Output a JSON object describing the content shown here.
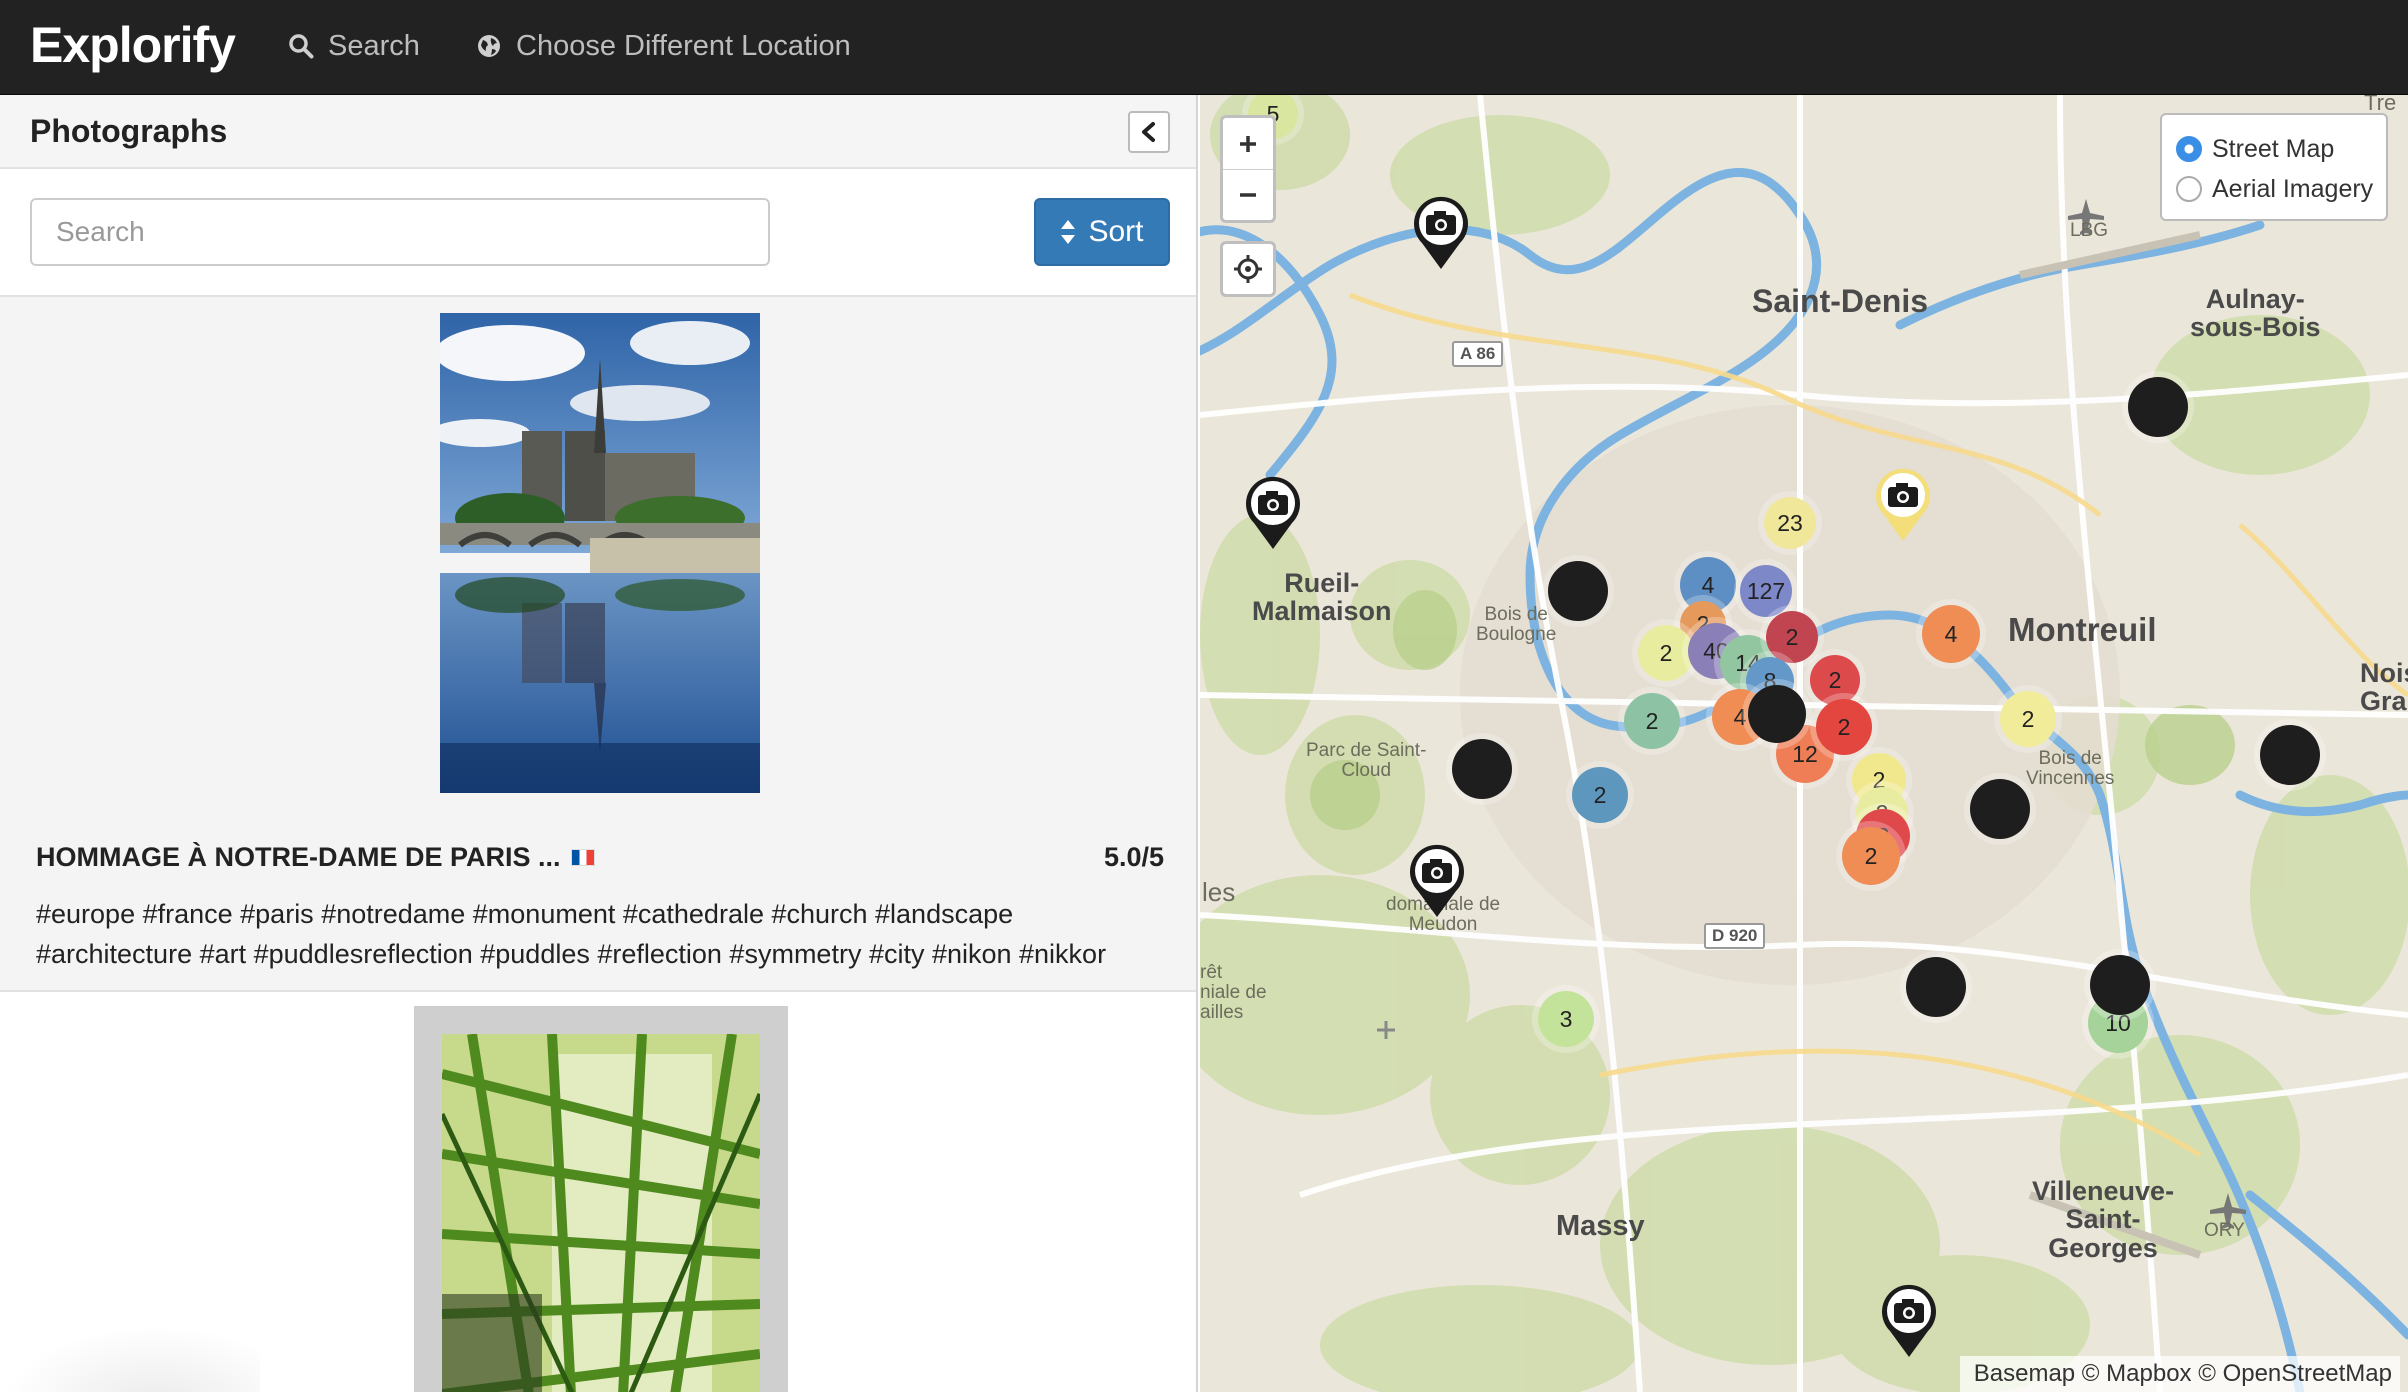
{
  "navbar": {
    "brand": "Explorify",
    "search_label": "Search",
    "location_label": "Choose Different Location"
  },
  "sidebar": {
    "title": "Photographs",
    "search_placeholder": "Search",
    "sort_label": "Sort",
    "photos": [
      {
        "title": "HOMMAGE À NOTRE-DAME DE PARIS ...",
        "rating": "5.0/5",
        "tags": "#europe #france #paris #notredame #monument #cathedrale #church #landscape #architecture #art #puddlesreflection #puddles #reflection #symmetry #city #nikon #nikkor"
      }
    ]
  },
  "map": {
    "layers": [
      "Street Map",
      "Aerial Imagery"
    ],
    "selected_layer": "Street Map",
    "attribution": "Basemap © Mapbox © OpenStreetMap",
    "places": {
      "saint_denis": "Saint-Denis",
      "aulnay": "Aulnay-\nsous-Bois",
      "rueil": "Rueil-\nMalmaison",
      "montreuil": "Montreuil",
      "noisy": "Nois\nGra",
      "massy": "Massy",
      "villeneuve": "Villeneuve-\nSaint-\nGeorges",
      "bois_boulogne": "Bois de\nBoulogne",
      "parc_saint_cloud": "Parc de Saint-\nCloud",
      "bois_vincennes": "Bois de\nVincennes",
      "meudon": "Fo\ndomaniale de\nMeudon",
      "les": "les",
      "foret": "rêt\nniale de\nailles",
      "lbg": "LBG",
      "ory": "ORY",
      "tre": "Tre"
    },
    "roads": {
      "a86": "A 86",
      "d920": "D 920"
    },
    "clusters": [
      {
        "count": "5",
        "color": "#d8e6a0"
      },
      {
        "count": "23",
        "color": "#f1e79a"
      },
      {
        "count": "4",
        "color": "#5e8fc4"
      },
      {
        "count": "127",
        "color": "#7d88c9"
      },
      {
        "count": "2",
        "color": "#e59a5c"
      },
      {
        "count": "2",
        "color": "#e8ec9e"
      },
      {
        "count": "40",
        "color": "#8b7fb8"
      },
      {
        "count": "14",
        "color": "#92c6a0"
      },
      {
        "count": "2",
        "color": "#c14550"
      },
      {
        "count": "8",
        "color": "#6398c9"
      },
      {
        "count": "4",
        "color": "#ef8d55"
      },
      {
        "count": "4",
        "color": "#ef8d55"
      },
      {
        "count": "12",
        "color": "#ef7e56"
      },
      {
        "count": "2",
        "color": "#8dc3a4"
      },
      {
        "count": "2",
        "color": "#5e97bd"
      },
      {
        "count": "2",
        "color": "#dd4a4c"
      },
      {
        "count": "2",
        "color": "#e3453f"
      },
      {
        "count": "2",
        "color": "#f1e88e"
      },
      {
        "count": "2",
        "color": "#e8eca1"
      },
      {
        "count": "2",
        "color": "#f1ec99"
      },
      {
        "count": "2",
        "color": "#e0494c"
      },
      {
        "count": "2",
        "color": "#ef8d55"
      },
      {
        "count": "3",
        "color": "#c4e39a"
      },
      {
        "count": "10",
        "color": "#a6d39a"
      }
    ]
  }
}
